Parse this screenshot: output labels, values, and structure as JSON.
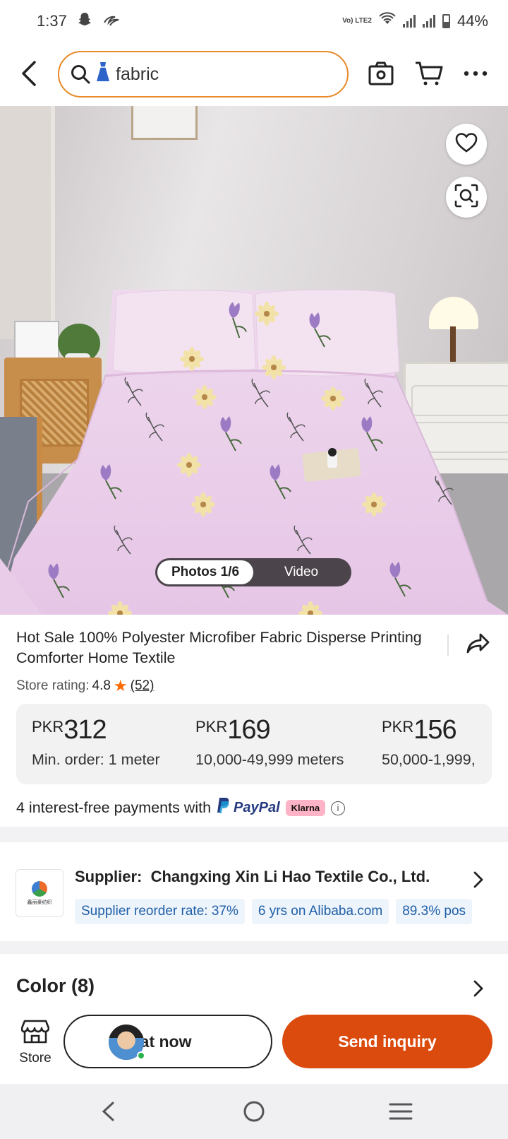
{
  "status_bar": {
    "time": "1:37",
    "carrier_label": "Vo) LTE2",
    "battery": "44%",
    "battery_level": 0.44,
    "icons": [
      "snapchat-icon",
      "alibaba-icon",
      "wifi-icon",
      "signal-icon",
      "signal-icon",
      "battery-icon"
    ]
  },
  "header": {
    "search_value": "fabric",
    "icons": [
      "back-arrow-icon",
      "search-icon",
      "dress-icon",
      "camera-icon",
      "cart-icon",
      "more-icon"
    ]
  },
  "gallery": {
    "photos_tab": "Photos 1/6",
    "video_tab": "Video",
    "icons": [
      "heart-icon",
      "image-search-icon"
    ]
  },
  "product": {
    "title": "Hot Sale 100% Polyester Microfiber Fabric Disperse Printing Comforter Home Textile",
    "rating_label": "Store rating:",
    "rating_value": "4.8",
    "rating_count": "(52)",
    "price_tiers": [
      {
        "currency": "PKR",
        "amount": "312",
        "condition": "Min. order: 1 meter"
      },
      {
        "currency": "PKR",
        "amount": "169",
        "condition": "10,000-49,999 meters"
      },
      {
        "currency": "PKR",
        "amount": "156",
        "condition": "50,000-1,999,"
      }
    ],
    "payments_text": "4 interest-free payments with",
    "paypal_label": "PayPal",
    "klarna_label": "Klarna"
  },
  "supplier": {
    "label": "Supplier:",
    "name": "Changxing Xin Li Hao Textile Co., Ltd.",
    "logo_text": "鑫丽豪纺织",
    "chips": [
      "Supplier reorder rate: 37%",
      "6 yrs on Alibaba.com",
      "89.3% pos"
    ]
  },
  "color": {
    "title": "Color (8)"
  },
  "action_bar": {
    "store_label": "Store",
    "chat_label": "Chat now",
    "inquiry_label": "Send inquiry"
  },
  "colors": {
    "accent": "#dc4b0e",
    "search_border": "#e88a2a",
    "chip_bg": "#eef4fb",
    "chip_text": "#1f5fa8",
    "star": "#ff6a00"
  }
}
